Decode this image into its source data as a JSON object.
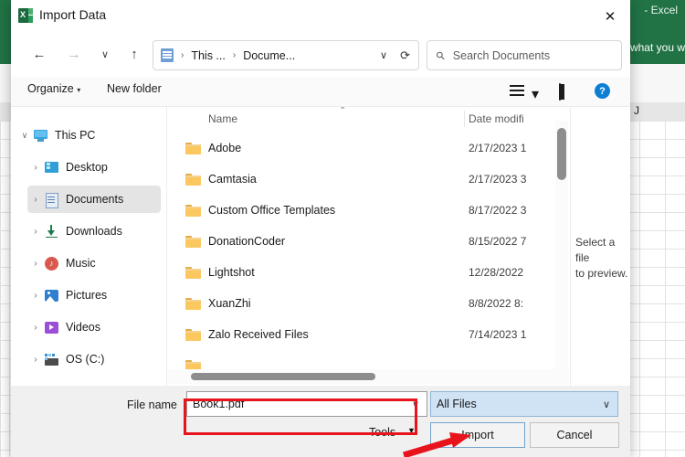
{
  "excel": {
    "title_suffix": "-  Excel",
    "ribbon_search_text": "what you w",
    "column_letter": "J"
  },
  "dialog": {
    "title": "Import Data",
    "app_icon": "excel-icon",
    "close_label": "✕"
  },
  "nav": {
    "back": "←",
    "forward": "→",
    "recent": "∨",
    "up": "↑",
    "breadcrumb": [
      "This ...",
      "Docume..."
    ],
    "breadcrumb_sep": "›",
    "address_chevron": "∨",
    "refresh": "⟳"
  },
  "search": {
    "placeholder": "Search Documents",
    "icon": "search-icon"
  },
  "commandbar": {
    "organize": "Organize",
    "organize_caret": "▾",
    "new_folder": "New folder",
    "view_caret": "▾",
    "help": "?"
  },
  "sidebar": {
    "items": [
      {
        "label": "This PC",
        "icon": "pc-icon",
        "expander": "∨",
        "expanded": true,
        "selected": false
      },
      {
        "label": "Desktop",
        "icon": "desktop-icon",
        "expander": "›",
        "expanded": false,
        "selected": false
      },
      {
        "label": "Documents",
        "icon": "documents-icon",
        "expander": "›",
        "expanded": false,
        "selected": true
      },
      {
        "label": "Downloads",
        "icon": "downloads-icon",
        "expander": "›",
        "expanded": false,
        "selected": false
      },
      {
        "label": "Music",
        "icon": "music-icon",
        "expander": "›",
        "expanded": false,
        "selected": false
      },
      {
        "label": "Pictures",
        "icon": "pictures-icon",
        "expander": "›",
        "expanded": false,
        "selected": false
      },
      {
        "label": "Videos",
        "icon": "videos-icon",
        "expander": "›",
        "expanded": false,
        "selected": false
      },
      {
        "label": "OS (C:)",
        "icon": "harddrive-icon",
        "expander": "›",
        "expanded": false,
        "selected": false
      }
    ]
  },
  "filelist": {
    "columns": [
      "Name",
      "Date modifi"
    ],
    "sort_indicator": "⌃",
    "rows": [
      {
        "name": "Adobe",
        "date": "2/17/2023 1",
        "icon": "folder-icon"
      },
      {
        "name": "Camtasia",
        "date": "2/17/2023 3",
        "icon": "folder-icon"
      },
      {
        "name": "Custom Office Templates",
        "date": "8/17/2022 3",
        "icon": "folder-icon"
      },
      {
        "name": "DonationCoder",
        "date": "8/15/2022 7",
        "icon": "folder-icon"
      },
      {
        "name": "Lightshot",
        "date": "12/28/2022",
        "icon": "folder-icon"
      },
      {
        "name": "XuanZhi",
        "date": "8/8/2022 8:",
        "icon": "folder-icon"
      },
      {
        "name": "Zalo Received Files",
        "date": "7/14/2023 1",
        "icon": "folder-icon"
      }
    ]
  },
  "preview": {
    "line1": "Select a file",
    "line2": "to preview."
  },
  "footer": {
    "file_name_label": "File name",
    "file_name_value": "Book1.pdf",
    "file_name_caret": "∨",
    "file_type_value": "All Files",
    "file_type_caret": "∨",
    "tools_label": "Tools",
    "tools_caret": "▼",
    "import_label": "Import",
    "cancel_label": "Cancel"
  },
  "colors": {
    "excel_green": "#217346",
    "highlight_red": "#e8141c",
    "selection_gray": "#e4e4e4",
    "filetype_blue": "#cfe3f5",
    "help_blue": "#0b7fd4"
  }
}
